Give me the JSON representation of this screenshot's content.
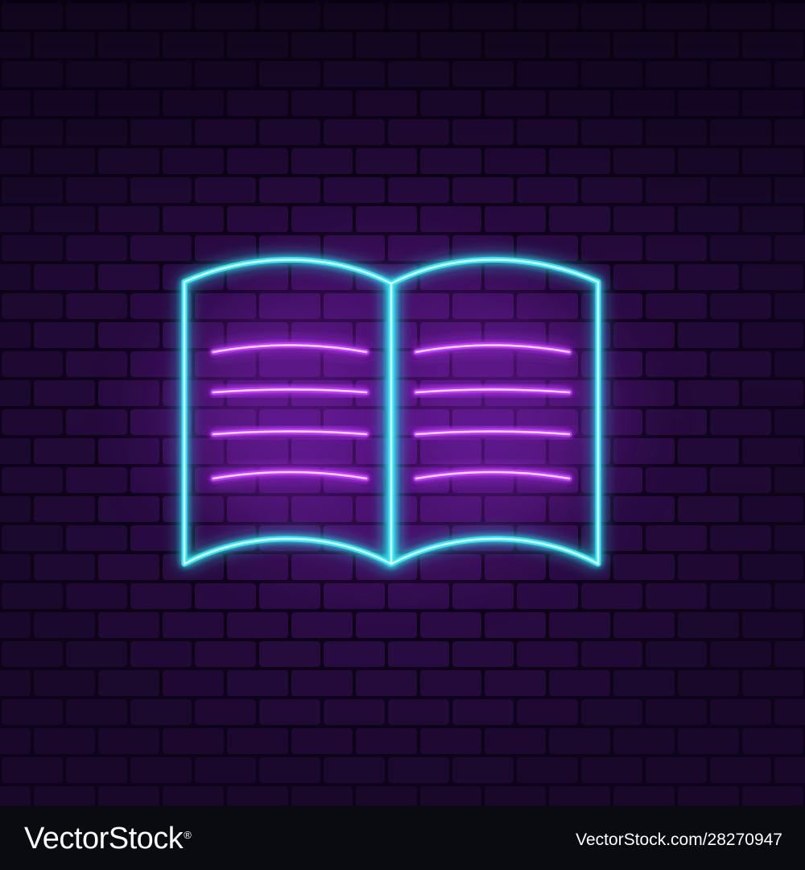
{
  "footer": {
    "brand": "VectorStock",
    "registered_mark": "®",
    "image_id": "VectorStock.com/28270947"
  },
  "colors": {
    "wall_top": "#1a0a30",
    "wall_glow": "#4a1470",
    "mortar": "#0d0419",
    "book_outline": "#36e6f5",
    "text_lines": "#c03cff",
    "footer_bg": "#0a0b11"
  },
  "icons": {
    "main": "open-book-icon"
  }
}
